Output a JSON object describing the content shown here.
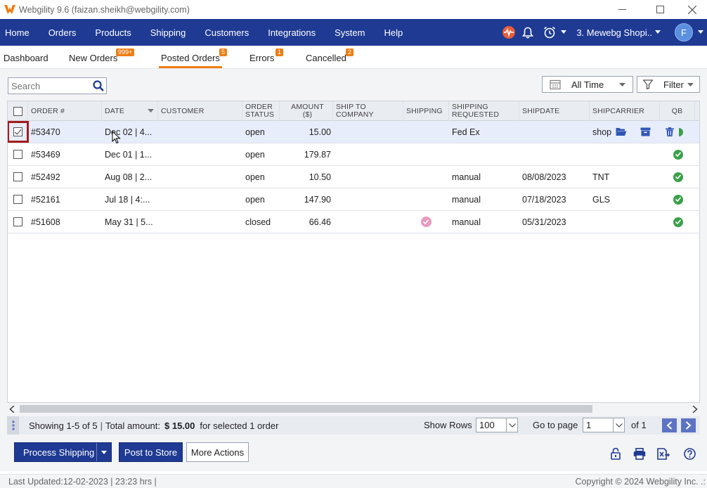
{
  "window": {
    "title": "Webgility 9.6 (faizan.sheikh@webgility.com)"
  },
  "nav": {
    "items": [
      "Home",
      "Orders",
      "Products",
      "Shipping",
      "Customers",
      "Integrations",
      "System",
      "Help"
    ],
    "store": "3. Mewebg Shopi..",
    "avatar": "F"
  },
  "tabs": {
    "dashboard": "Dashboard",
    "new_orders": "New Orders",
    "new_orders_badge": "999+",
    "posted": "Posted Orders",
    "posted_badge": "5",
    "errors": "Errors",
    "errors_badge": "1",
    "cancelled": "Cancelled",
    "cancelled_badge": "2"
  },
  "toolbar": {
    "search_placeholder": "Search",
    "range": "All Time",
    "filter": "Filter"
  },
  "table": {
    "headers": {
      "order": "ORDER #",
      "date": "DATE",
      "customer": "CUSTOMER",
      "status": "ORDER STATUS",
      "amount": "AMOUNT ($)",
      "ship_to": "SHIP TO COMPANY",
      "shipping": "SHIPPING",
      "requested": "SHIPPING REQUESTED",
      "shipdate": "SHIPDATE",
      "carrier": "SHIPCARRIER",
      "qb": "QB"
    },
    "rows": [
      {
        "order": "#53470",
        "date": "Dec 02 | 4...",
        "customer": "",
        "status": "open",
        "amount": "15.00",
        "ship_to": "",
        "requested": "Fed Ex",
        "shipdate": "",
        "carrier": "shop",
        "checked": true
      },
      {
        "order": "#53469",
        "date": "Dec 01 | 1...",
        "customer": "",
        "status": "open",
        "amount": "179.87",
        "ship_to": "",
        "requested": "",
        "shipdate": "",
        "carrier": "",
        "checked": false
      },
      {
        "order": "#52492",
        "date": "Aug 08 | 2...",
        "customer": "",
        "status": "open",
        "amount": "10.50",
        "ship_to": "",
        "requested": "manual",
        "shipdate": "08/08/2023",
        "carrier": "TNT",
        "checked": false
      },
      {
        "order": "#52161",
        "date": "Jul 18 | 4:...",
        "customer": "",
        "status": "open",
        "amount": "147.90",
        "ship_to": "",
        "requested": "manual",
        "shipdate": "07/18/2023",
        "carrier": "GLS",
        "checked": false
      },
      {
        "order": "#51608",
        "date": "May 31 | 5...",
        "customer": "",
        "status": "closed",
        "amount": "66.46",
        "ship_to": "",
        "requested": "manual",
        "shipdate": "05/31/2023",
        "carrier": "",
        "checked": false
      }
    ]
  },
  "status": {
    "showing": "Showing 1-5 of 5",
    "total_label": "Total amount:",
    "total_value": "$ 15.00",
    "selected": "for selected 1 order",
    "show_rows_label": "Show Rows",
    "show_rows_value": "100",
    "go_to_label": "Go to page",
    "page_value": "1",
    "of_pages": "of 1"
  },
  "actions": {
    "process_shipping": "Process Shipping",
    "post_to_store": "Post to Store",
    "more_actions": "More Actions"
  },
  "footer": {
    "last_updated": "Last Updated:12-02-2023 | 23:23 hrs |",
    "copyright": "Copyright © 2024 Webgility Inc. .:"
  }
}
